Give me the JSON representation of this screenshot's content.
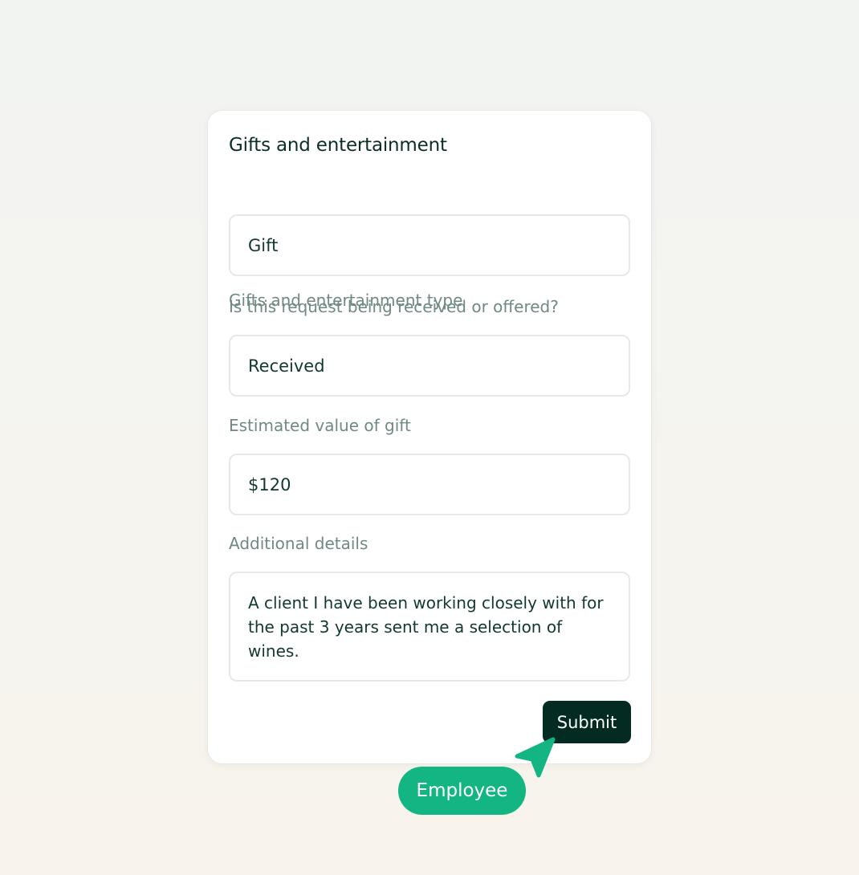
{
  "form": {
    "title": "Gifts and entertainment",
    "fields": [
      {
        "label": "Gifts and entertainment type",
        "value": "Gift"
      },
      {
        "label": "Is this request being received or offered?",
        "value": "Received"
      },
      {
        "label": "Estimated value of gift",
        "value": "$120"
      },
      {
        "label": "Additional details",
        "value": "A client I have been working closely with for the past 3 years sent me a selection of wines."
      }
    ],
    "submit_label": "Submit"
  },
  "cursor": {
    "icon": "pointer-arrow-icon",
    "color": "#13b583",
    "badge_label": "Employee"
  },
  "colors": {
    "accent": "#13b583",
    "button": "#032b21",
    "title_text": "#0d2e22",
    "label_text": "#6f8a7e"
  }
}
